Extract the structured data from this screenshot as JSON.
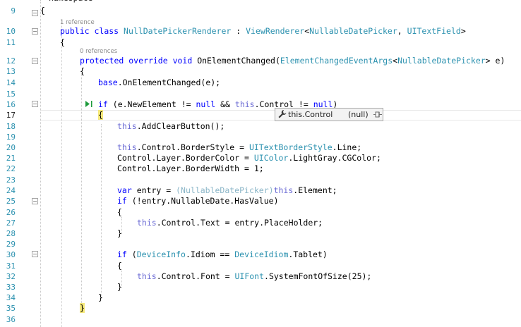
{
  "editor": {
    "lines": [
      {
        "n": "9",
        "tokens": [
          {
            "t": "{"
          }
        ]
      },
      {
        "n": "10",
        "tokens": [
          {
            "t": "public ",
            "c": "kw"
          },
          {
            "t": "class ",
            "c": "kw"
          },
          {
            "t": "NullDatePickerRenderer",
            "c": "ty"
          },
          {
            "t": " : "
          },
          {
            "t": "ViewRenderer",
            "c": "ty"
          },
          {
            "t": "<"
          },
          {
            "t": "NullableDatePicker",
            "c": "ty"
          },
          {
            "t": ", "
          },
          {
            "t": "UITextField",
            "c": "ty"
          },
          {
            "t": ">"
          }
        ]
      },
      {
        "n": "11",
        "tokens": [
          {
            "t": "{"
          }
        ]
      },
      {
        "n": "12",
        "tokens": [
          {
            "t": "protected ",
            "c": "kw"
          },
          {
            "t": "override ",
            "c": "kw"
          },
          {
            "t": "void ",
            "c": "kw"
          },
          {
            "t": "OnElementChanged("
          },
          {
            "t": "ElementChangedEventArgs",
            "c": "ty"
          },
          {
            "t": "<"
          },
          {
            "t": "NullableDatePicker",
            "c": "ty"
          },
          {
            "t": "> e)"
          }
        ]
      },
      {
        "n": "13",
        "tokens": [
          {
            "t": "{"
          }
        ]
      },
      {
        "n": "14",
        "tokens": [
          {
            "t": "base",
            "c": "kw"
          },
          {
            "t": ".OnElementChanged(e);"
          }
        ]
      },
      {
        "n": "15",
        "tokens": []
      },
      {
        "n": "16",
        "tokens": [
          {
            "t": "if",
            "c": "kw"
          },
          {
            "t": " (e.NewElement != "
          },
          {
            "t": "null",
            "c": "kw"
          },
          {
            "t": " && "
          },
          {
            "t": "this",
            "c": "kw2"
          },
          {
            "t": ".Control != "
          },
          {
            "t": "null",
            "c": "kw"
          },
          {
            "t": ")"
          }
        ]
      },
      {
        "n": "17",
        "tokens": [
          {
            "t": "{",
            "c": "brace"
          }
        ]
      },
      {
        "n": "18",
        "tokens": [
          {
            "t": "this",
            "c": "kw2"
          },
          {
            "t": ".AddClearButton();"
          }
        ]
      },
      {
        "n": "19",
        "tokens": []
      },
      {
        "n": "20",
        "tokens": [
          {
            "t": "this",
            "c": "kw2"
          },
          {
            "t": ".Control.BorderStyle = "
          },
          {
            "t": "UITextBorderStyle",
            "c": "ty"
          },
          {
            "t": ".Line;"
          }
        ]
      },
      {
        "n": "21",
        "tokens": [
          {
            "t": "Control.Layer.BorderColor = "
          },
          {
            "t": "UIColor",
            "c": "ty"
          },
          {
            "t": ".LightGray.CGColor;"
          }
        ]
      },
      {
        "n": "22",
        "tokens": [
          {
            "t": "Control.Layer.BorderWidth = 1;"
          }
        ]
      },
      {
        "n": "23",
        "tokens": []
      },
      {
        "n": "24",
        "tokens": [
          {
            "t": "var ",
            "c": "kw"
          },
          {
            "t": "entry = "
          },
          {
            "t": "(NullableDatePicker)",
            "c": "fade"
          },
          {
            "t": "this",
            "c": "kw2"
          },
          {
            "t": ".Element;"
          }
        ]
      },
      {
        "n": "25",
        "tokens": [
          {
            "t": "if",
            "c": "kw"
          },
          {
            "t": " (!entry.NullableDate.HasValue)"
          }
        ]
      },
      {
        "n": "26",
        "tokens": [
          {
            "t": "{"
          }
        ]
      },
      {
        "n": "27",
        "tokens": [
          {
            "t": "this",
            "c": "kw2"
          },
          {
            "t": ".Control.Text = entry.PlaceHolder;"
          }
        ]
      },
      {
        "n": "28",
        "tokens": [
          {
            "t": "}"
          }
        ]
      },
      {
        "n": "29",
        "tokens": []
      },
      {
        "n": "30",
        "tokens": [
          {
            "t": "if",
            "c": "kw"
          },
          {
            "t": " ("
          },
          {
            "t": "DeviceInfo",
            "c": "ty"
          },
          {
            "t": ".Idiom == "
          },
          {
            "t": "DeviceIdiom",
            "c": "ty"
          },
          {
            "t": ".Tablet)"
          }
        ]
      },
      {
        "n": "31",
        "tokens": [
          {
            "t": "{"
          }
        ]
      },
      {
        "n": "32",
        "tokens": [
          {
            "t": "this",
            "c": "kw2"
          },
          {
            "t": ".Control.Font = "
          },
          {
            "t": "UIFont",
            "c": "ty"
          },
          {
            "t": ".SystemFontOfSize(25);"
          }
        ]
      },
      {
        "n": "33",
        "tokens": [
          {
            "t": "}"
          }
        ]
      },
      {
        "n": "34",
        "tokens": [
          {
            "t": "}"
          }
        ]
      },
      {
        "n": "35",
        "tokens": [
          {
            "t": "}",
            "c": "brace"
          }
        ]
      },
      {
        "n": "36",
        "tokens": []
      }
    ],
    "references": [
      {
        "text": "1 reference",
        "before_line": "10"
      },
      {
        "text": "0 references",
        "before_line": "12"
      }
    ],
    "current_line": "17"
  },
  "tooltip": {
    "expression": "this.Control",
    "value": "(null)",
    "icon": "wrench-icon",
    "pin_icon": "pin-icon"
  },
  "colors": {
    "keyword": "#0000ff",
    "type": "#2b91af",
    "line_number": "#2b91af",
    "brace_highlight": "#f5e87a"
  }
}
